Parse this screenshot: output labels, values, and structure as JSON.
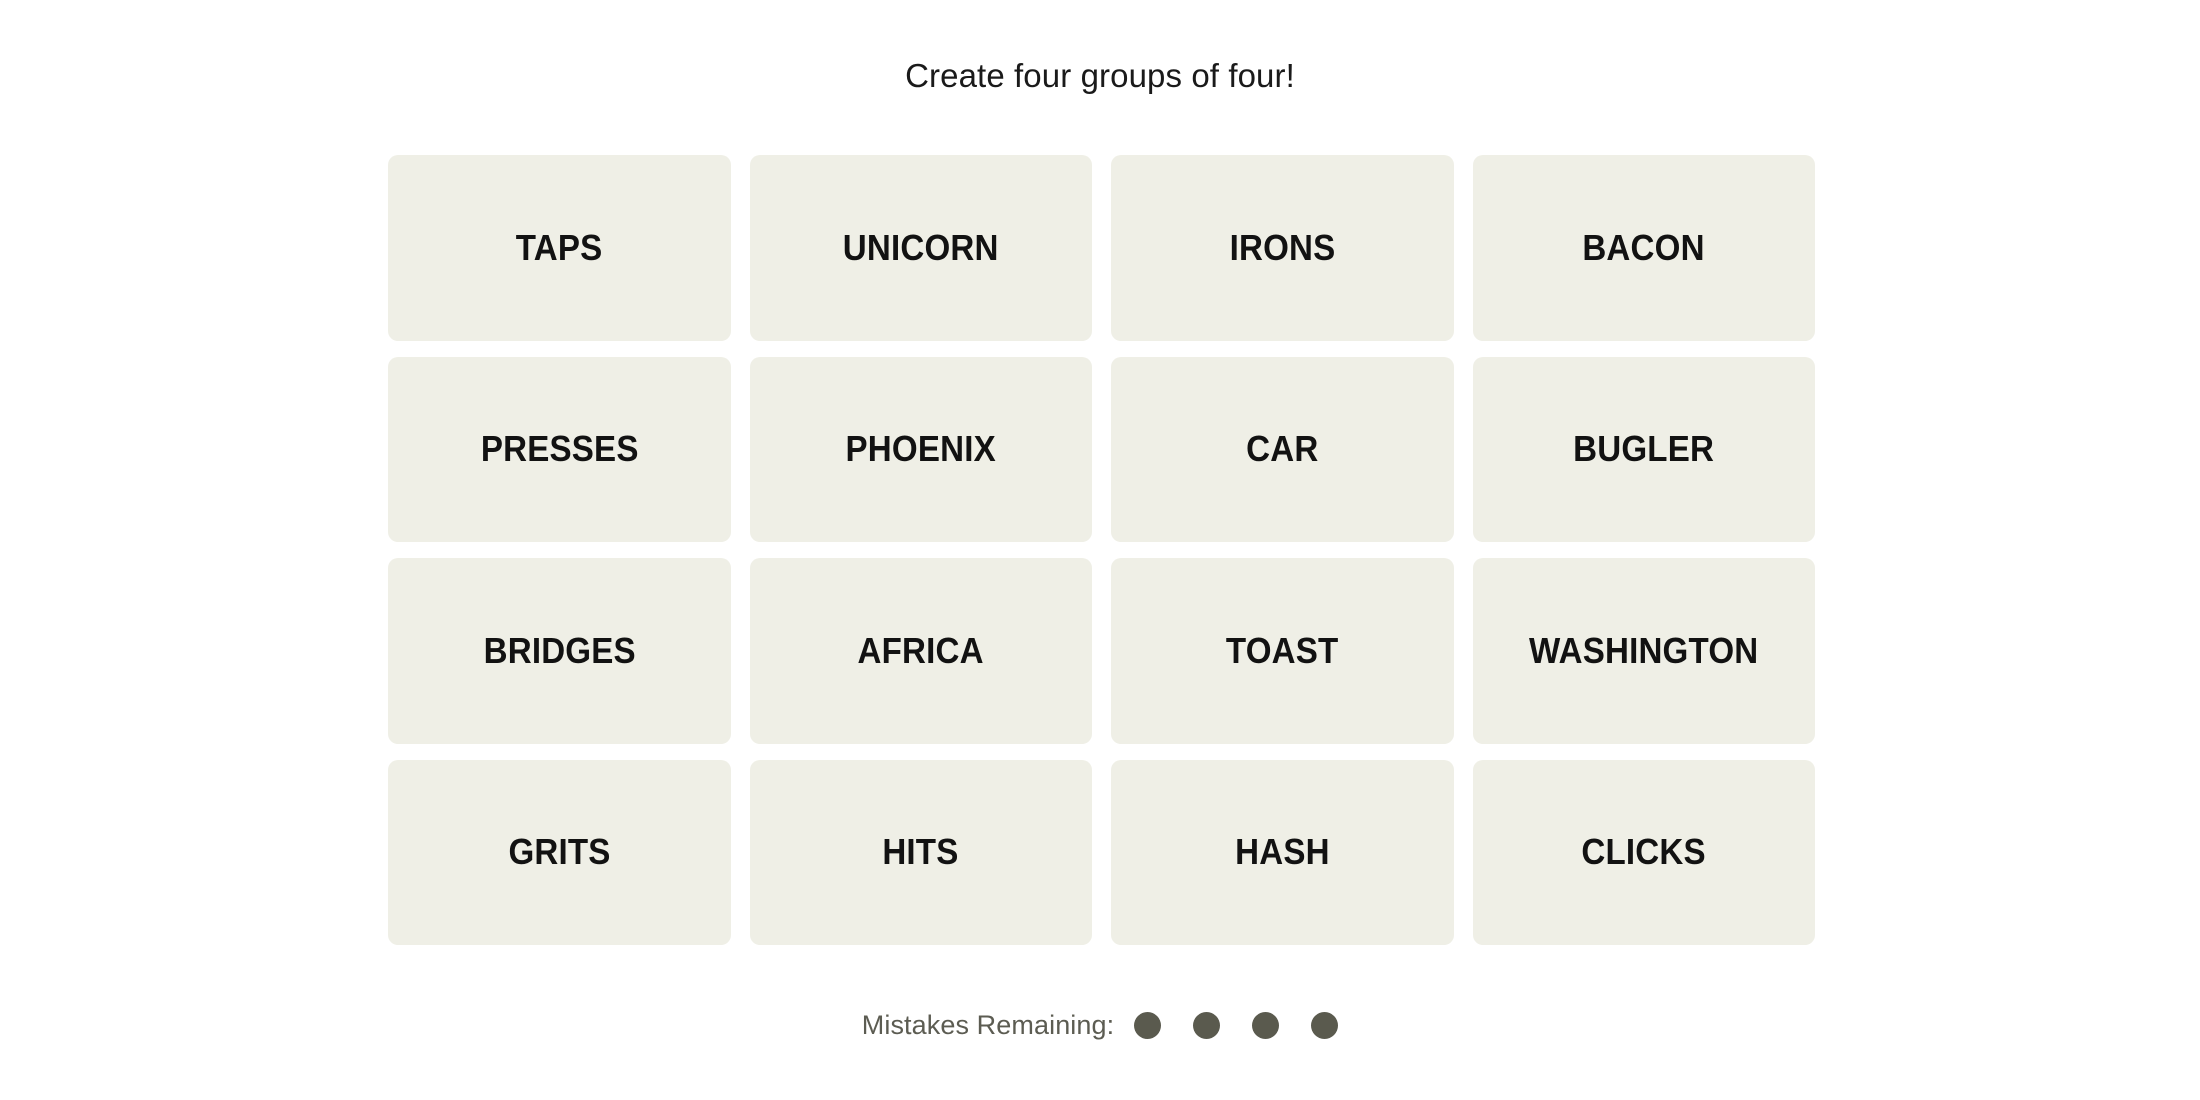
{
  "page": {
    "background_color": "#ffffff",
    "title": "Create four groups of four!"
  },
  "board": {
    "rows": 4,
    "columns": 4,
    "tile_color": "#EFEFE6",
    "tile_text_color": "#121212",
    "tiles": [
      {
        "label": "TAPS"
      },
      {
        "label": "UNICORN"
      },
      {
        "label": "IRONS"
      },
      {
        "label": "BACON"
      },
      {
        "label": "PRESSES"
      },
      {
        "label": "PHOENIX"
      },
      {
        "label": "CAR"
      },
      {
        "label": "BUGLER"
      },
      {
        "label": "BRIDGES"
      },
      {
        "label": "AFRICA"
      },
      {
        "label": "TOAST"
      },
      {
        "label": "WASHINGTON"
      },
      {
        "label": "GRITS"
      },
      {
        "label": "HITS"
      },
      {
        "label": "HASH"
      },
      {
        "label": "CLICKS"
      }
    ]
  },
  "footer": {
    "mistakes_label": "Mistakes Remaining:",
    "mistakes_remaining": 4,
    "dot_color": "#5A5A4E",
    "dots": [
      {
        "state": "remaining"
      },
      {
        "state": "remaining"
      },
      {
        "state": "remaining"
      },
      {
        "state": "remaining"
      }
    ]
  }
}
